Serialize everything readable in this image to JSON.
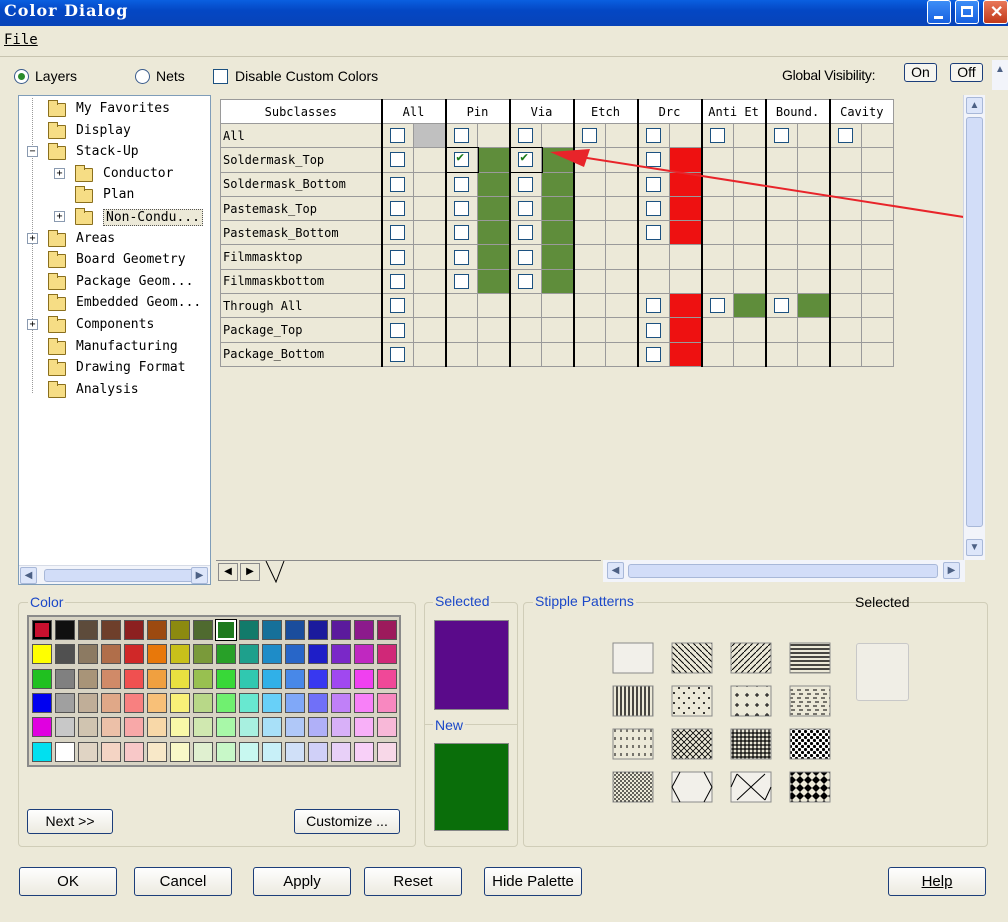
{
  "window": {
    "title": "Color Dialog"
  },
  "menu": {
    "file": "File"
  },
  "top": {
    "layers_label": "Layers",
    "nets_label": "Nets",
    "disable_custom": "Disable Custom Colors",
    "global_visibility": "Global Visibility:",
    "on": "On",
    "off": "Off"
  },
  "tree": [
    {
      "label": "My Favorites",
      "indent": 0,
      "exp": ""
    },
    {
      "label": "Display",
      "indent": 0,
      "exp": ""
    },
    {
      "label": "Stack-Up",
      "indent": 0,
      "exp": "−"
    },
    {
      "label": "Conductor",
      "indent": 1,
      "exp": "+"
    },
    {
      "label": "Plan",
      "indent": 1,
      "exp": ""
    },
    {
      "label": "Non-Condu...",
      "indent": 1,
      "exp": "+",
      "selected": true
    },
    {
      "label": "Areas",
      "indent": 0,
      "exp": "+"
    },
    {
      "label": "Board Geometry",
      "indent": 0,
      "exp": ""
    },
    {
      "label": "Package Geom...",
      "indent": 0,
      "exp": ""
    },
    {
      "label": "Embedded Geom...",
      "indent": 0,
      "exp": ""
    },
    {
      "label": "Components",
      "indent": 0,
      "exp": "+"
    },
    {
      "label": "Manufacturing",
      "indent": 0,
      "exp": ""
    },
    {
      "label": "Drawing Format",
      "indent": 0,
      "exp": ""
    },
    {
      "label": "Analysis",
      "indent": 0,
      "exp": ""
    }
  ],
  "grid": {
    "headers": [
      "Subclasses",
      "All",
      "Pin",
      "Via",
      "Etch",
      "Drc",
      "Anti Et",
      "Bound.",
      "Cavity"
    ],
    "rows": [
      {
        "name": "All",
        "cells": [
          "c",
          "s",
          "c",
          "",
          "c",
          "",
          "c",
          "",
          "c",
          "",
          "c",
          "",
          "c",
          "",
          "c",
          ""
        ]
      },
      {
        "name": "Soldermask_Top",
        "cells": [
          "c",
          "",
          "C",
          "g",
          "C",
          "g",
          "",
          "",
          "c",
          "r",
          "",
          "",
          "",
          "",
          "",
          ""
        ]
      },
      {
        "name": "Soldermask_Bottom",
        "cells": [
          "c",
          "",
          "c",
          "g",
          "c",
          "g",
          "",
          "",
          "c",
          "r",
          "",
          "",
          "",
          "",
          "",
          ""
        ]
      },
      {
        "name": "Pastemask_Top",
        "cells": [
          "c",
          "",
          "c",
          "g",
          "c",
          "g",
          "",
          "",
          "c",
          "r",
          "",
          "",
          "",
          "",
          "",
          ""
        ]
      },
      {
        "name": "Pastemask_Bottom",
        "cells": [
          "c",
          "",
          "c",
          "g",
          "c",
          "g",
          "",
          "",
          "c",
          "r",
          "",
          "",
          "",
          "",
          "",
          ""
        ]
      },
      {
        "name": "Filmmasktop",
        "cells": [
          "c",
          "",
          "c",
          "g",
          "c",
          "g",
          "",
          "",
          "",
          "",
          "",
          "",
          "",
          "",
          "",
          ""
        ]
      },
      {
        "name": "Filmmaskbottom",
        "cells": [
          "c",
          "",
          "c",
          "g",
          "c",
          "g",
          "",
          "",
          "",
          "",
          "",
          "",
          "",
          "",
          "",
          ""
        ]
      },
      {
        "name": "Through All",
        "cells": [
          "c",
          "",
          "",
          "",
          "",
          "",
          "",
          "",
          "c",
          "r",
          "c",
          "g",
          "c",
          "g",
          "",
          ""
        ]
      },
      {
        "name": "Package_Top",
        "cells": [
          "c",
          "",
          "",
          "",
          "",
          "",
          "",
          "",
          "c",
          "r",
          "",
          "",
          "",
          "",
          "",
          ""
        ]
      },
      {
        "name": "Package_Bottom",
        "cells": [
          "c",
          "",
          "",
          "",
          "",
          "",
          "",
          "",
          "c",
          "r",
          "",
          "",
          "",
          "",
          "",
          ""
        ]
      }
    ]
  },
  "color": {
    "group_label": "Color",
    "next": "Next >>",
    "customize": "Customize ...",
    "palette": [
      [
        "#c8102e",
        "#101010",
        "#5d4b3b",
        "#6e3f2b",
        "#8c2020",
        "#9c4a10",
        "#8c8a10",
        "#4f6a2f",
        "#1f7a1f",
        "#127a6a",
        "#16709a",
        "#1a4d9c",
        "#1a1a9c",
        "#5b1a9c",
        "#8c1a8c",
        "#9c1a5c"
      ],
      [
        "#ffff00",
        "#505050",
        "#8c7a62",
        "#b06e4a",
        "#d02828",
        "#e8780a",
        "#c8c01a",
        "#7a9a3a",
        "#28a028",
        "#1ea08c",
        "#1e8cc8",
        "#2866c8",
        "#1e1ec8",
        "#7a28c8",
        "#c028c0",
        "#d02878"
      ],
      [
        "#20c020",
        "#808080",
        "#a89478",
        "#d08a68",
        "#f05050",
        "#f0a040",
        "#e8e040",
        "#98c050",
        "#38d838",
        "#30c8b0",
        "#30b0e8",
        "#4888e8",
        "#3838f0",
        "#a048f0",
        "#f040f0",
        "#f04898"
      ],
      [
        "#0000f0",
        "#a0a0a0",
        "#c0ae98",
        "#e0a888",
        "#f88080",
        "#f8c078",
        "#f8f078",
        "#b8d888",
        "#70f070",
        "#68e8d0",
        "#68d0f8",
        "#80a8f8",
        "#7070f8",
        "#c080f8",
        "#f880f8",
        "#f888c0"
      ],
      [
        "#e000e0",
        "#c8c8c8",
        "#d0c4b0",
        "#ecc0a8",
        "#f8a8a8",
        "#f8d8a8",
        "#f8f8a8",
        "#d0e8b0",
        "#a8f8a8",
        "#a8f0e0",
        "#a8e0f8",
        "#b0c8f8",
        "#b0b0f8",
        "#d8b0f8",
        "#f8b0f8",
        "#f8b8d8"
      ],
      [
        "#00e0f0",
        "#ffffff",
        "#e0d4c4",
        "#f4d4c4",
        "#f8c8c8",
        "#f8e8c8",
        "#f8f8c8",
        "#e0f0d0",
        "#c8f8c8",
        "#c8f8f0",
        "#c8f0f8",
        "#d0e0f8",
        "#d0d0f8",
        "#e8d0f8",
        "#f8d0f8",
        "#f8d8e8"
      ]
    ]
  },
  "selected_new": {
    "selected_label": "Selected",
    "new_label": "New",
    "selected_color": "#5a0a8a",
    "new_color": "#0a6e0a"
  },
  "stipple": {
    "group_label": "Stipple Patterns",
    "selected_label": "Selected"
  },
  "buttons": {
    "ok": "OK",
    "cancel": "Cancel",
    "apply": "Apply",
    "reset": "Reset",
    "hide_palette": "Hide Palette",
    "help": "Help"
  }
}
